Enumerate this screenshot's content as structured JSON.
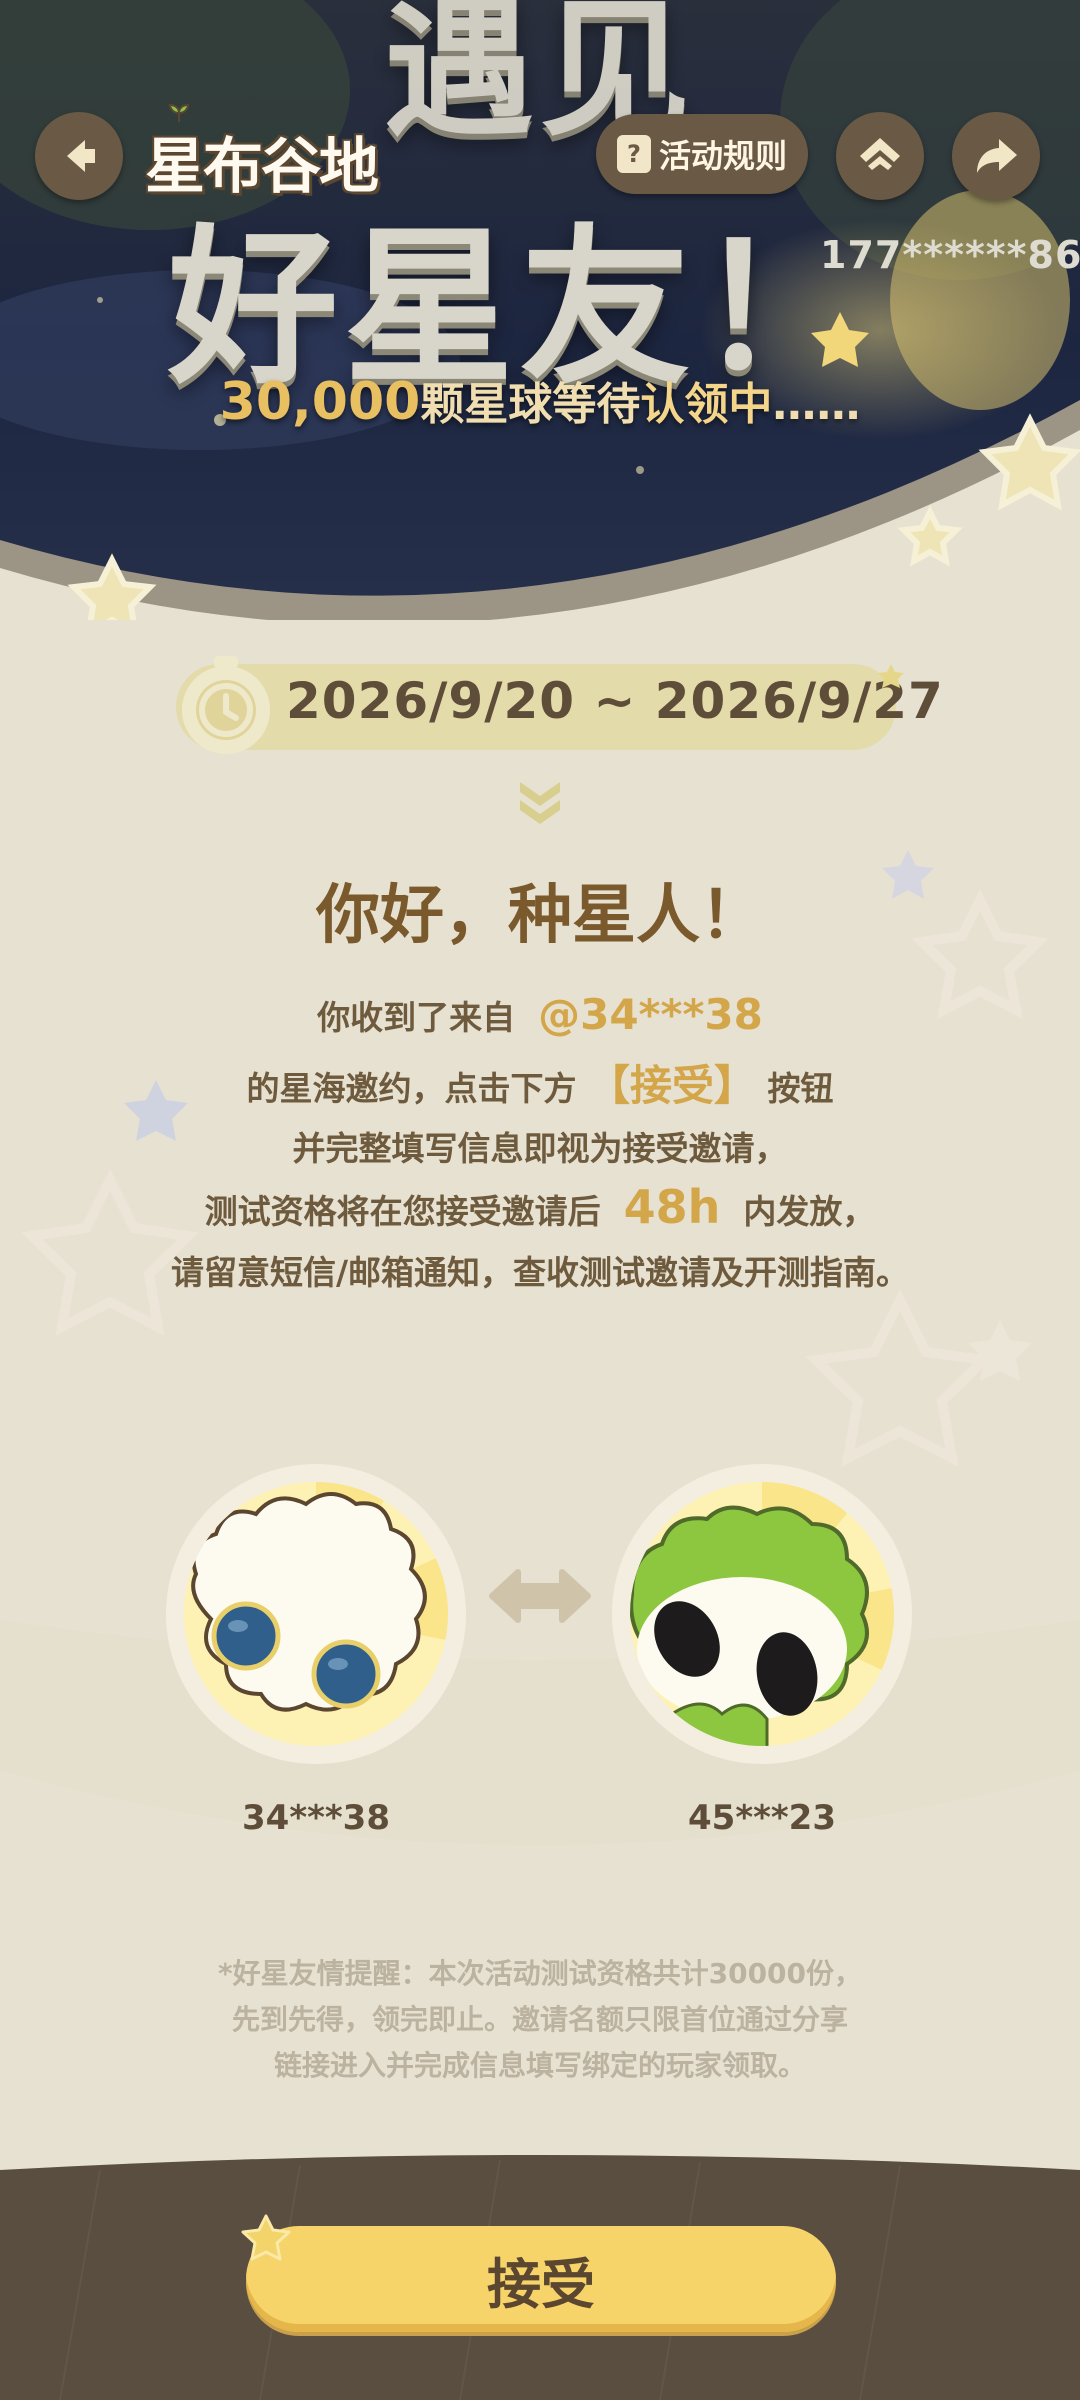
{
  "header": {
    "title_top": "遇见",
    "title_main": "好星友！",
    "subtitle_num": "30,000",
    "subtitle_mid": "颗星球等待",
    "subtitle_hl": "认领中",
    "subtitle_tail": "……",
    "logo_text": "星布谷地",
    "rules_icon": "?",
    "rules_label": "活动规则",
    "phone_masked": "177******86",
    "icons": [
      "back-icon",
      "home-icon",
      "share-icon"
    ]
  },
  "event": {
    "date_range": "2026/9/20 ~ 2026/9/27"
  },
  "message": {
    "greeting": "你好，种星人！",
    "line1_pre": "你收到了来自",
    "line1_user": "@34***38",
    "line2_pre": "的星海邀约，点击下方",
    "line2_btn": "【接受】",
    "line2_post": "按钮",
    "line3": "并完整填写信息即视为接受邀请，",
    "line4_pre": "测试资格将在您接受邀请后",
    "line4_time": "48h",
    "line4_post": "内发放，",
    "line5": "请留意短信/邮箱通知，查收测试邀请及开测指南。"
  },
  "players": {
    "inviter": "34***38",
    "invitee": "45***23"
  },
  "notice": {
    "line1": "*好星友情提醒：本次活动测试资格共计30000份，",
    "line2": "先到先得，领完即止。邀请名额只限首位通过分享",
    "line3": "链接进入并完成信息填写绑定的玩家领取。"
  },
  "footer": {
    "accept_label": "接受"
  },
  "colors": {
    "background": "#e7e1d2",
    "accent_gold": "#d4a64a",
    "button_yellow": "#f6d46a",
    "dark_brown": "#5b4630",
    "banner_navy": "#1e2740"
  }
}
